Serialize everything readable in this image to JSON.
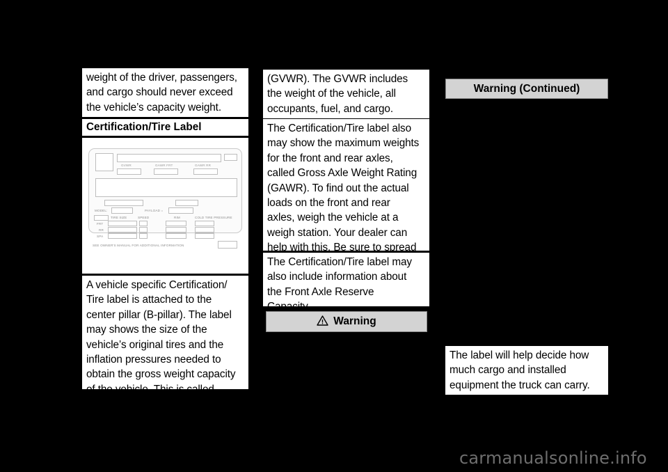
{
  "page": {
    "background_color": "#000000",
    "text_block_color": "#ffffff",
    "warning_bar_color": "#d3d3d3",
    "watermark": "carmanualsonline.info"
  },
  "column_left": {
    "paragraph_1": "weight of the driver, passengers,\nand cargo should never exceed\nthe vehicle’s capacity weight.",
    "heading_1": "Certification/Tire Label",
    "paragraph_2": "A vehicle specific Certification/\nTire label is attached to the\ncenter pillar (B-pillar). The label\nmay shows the size of the\nvehicle’s original tires and the\ninflation pressures needed to\nobtain the gross weight capacity\nof the vehicle. This is called\nGross Vehicle Weight Rating"
  },
  "column_middle": {
    "paragraph_1": "(GVWR). The GVWR includes\nthe weight of the vehicle, all\noccupants, fuel, and cargo.",
    "paragraph_2": "The Certification/Tire label also\nmay show the maximum weights\nfor the front and rear axles,\ncalled Gross Axle Weight Rating\n(GAWR). To find out the actual\nloads on the front and rear\naxles, weigh the vehicle at a\nweigh station. Your dealer can\nhelp with this. Be sure to spread\nyour load equally on both sides\nof the centerline.",
    "paragraph_3": "The Certification/Tire label may\nalso include information about\nthe Front Axle Reserve\nCapacity.",
    "warning_label": "Warning"
  },
  "column_right": {
    "warning_continued_label": "Warning  (Continued)",
    "paragraph_1": "The label will help decide how\nmuch cargo and installed\nequipment the truck can carry."
  },
  "certification_label_figure": {
    "caption": "Certification/Tire Label illustration",
    "fields": {
      "gvwr": "GVWR",
      "gawr_frt": "GAWR FRT",
      "gawr_rr": "GAWR RR",
      "model": "MODEL:",
      "payload": "PAYLOAD =",
      "tire_size": "TIRE SIZE",
      "speed": "SPEED",
      "rim": "RIM",
      "cold_tire_pressure": "COLD TIRE PRESSURE",
      "row_frt": "FRT",
      "row_rr": "RR",
      "row_spa": "SPA",
      "footer_note": "SEE OWNER'S MANUAL FOR ADDITIONAL INFORMATION"
    }
  }
}
